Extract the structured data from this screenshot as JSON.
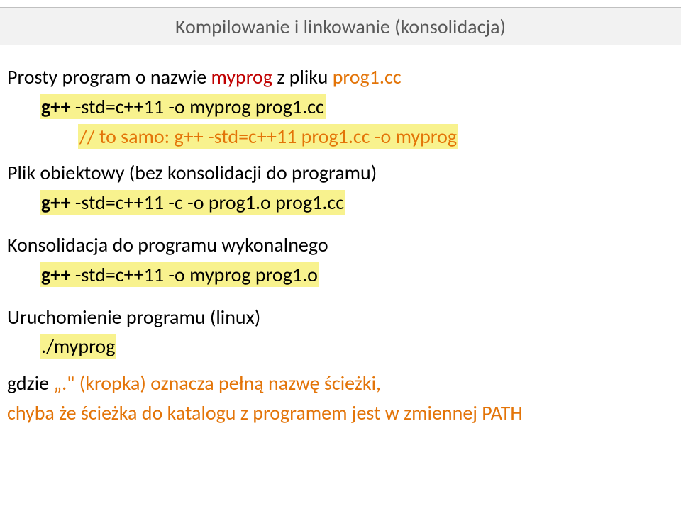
{
  "title": "Kompilowanie i linkowanie (konsolidacja)",
  "l1a": "Prosty program o nazwie ",
  "l1b": "myprog",
  "l1c": " z pliku ",
  "l1d": "prog1.cc",
  "cmd1a": "g++",
  "cmd1b": " -std=c++11 -o  myprog  prog1.cc",
  "cmd1c": "// to samo: g++ -std=c++11 prog1.cc -o myprog",
  "l2": "Plik obiektowy (bez konsolidacji do programu)",
  "cmd2a": "g++",
  "cmd2b": " -std=c++11 -c -o  prog1.o  prog1.cc",
  "l3": "Konsolidacja do programu wykonalnego",
  "cmd3a": "g++",
  "cmd3b": " -std=c++11 -o  myprog  prog1.o",
  "l4": "Uruchomienie programu (linux)",
  "cmd4": "./myprog",
  "l5a": "gdzie ",
  "l5b": "„.\" (kropka) oznacza pełną nazwę ścieżki,",
  "l6": "chyba że ścieżka do katalogu z programem jest w zmiennej PATH"
}
